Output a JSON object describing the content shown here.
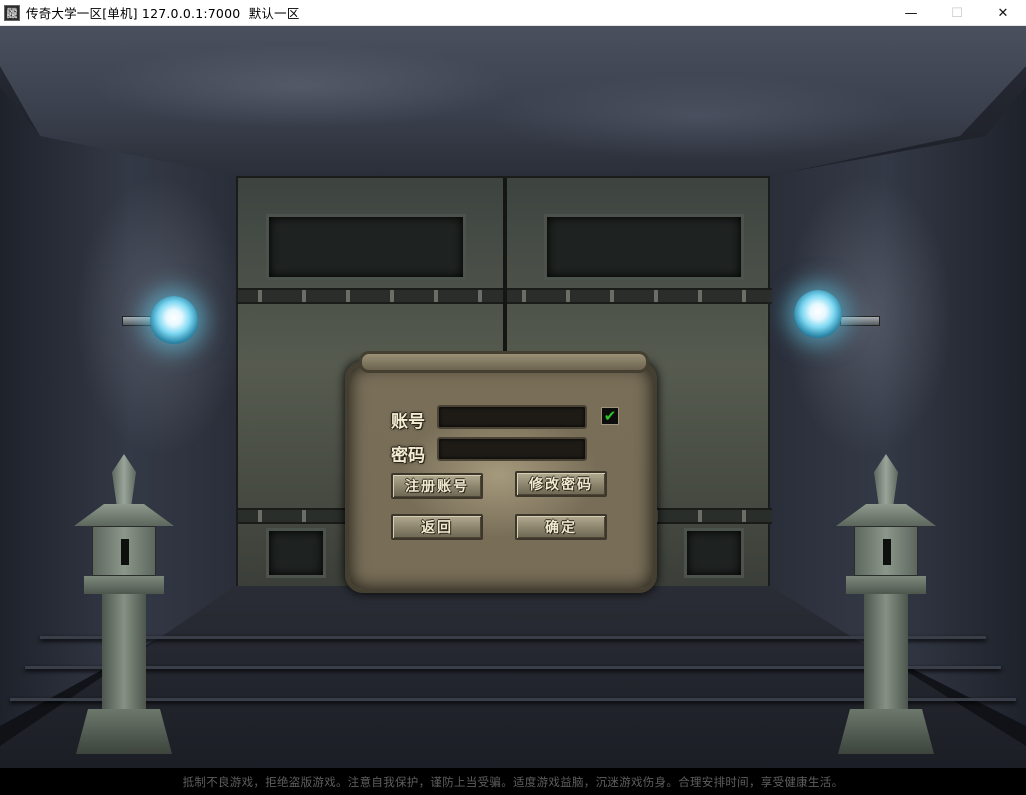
{
  "window": {
    "icon_text": "龖",
    "title": "传奇大学一区[单机] 127.0.0.1:7000  默认一区",
    "controls": {
      "minimize": "—",
      "maximize": "☐",
      "close": "✕"
    }
  },
  "login": {
    "account_label": "账号",
    "password_label": "密码",
    "account_value": "",
    "password_value": "",
    "remember_checked": true,
    "check_mark": "✔",
    "buttons": {
      "register": "注册账号",
      "change_password": "修改密码",
      "back": "返回",
      "confirm": "确定"
    }
  },
  "colors": {
    "checkmark": "#2ec22e",
    "orb_glow": "#7ed8f2"
  },
  "footer": {
    "notice": "抵制不良游戏，拒绝盗版游戏。注意自我保护，谨防上当受骗。适度游戏益脑，沉迷游戏伤身。合理安排时间，享受健康生活。"
  }
}
